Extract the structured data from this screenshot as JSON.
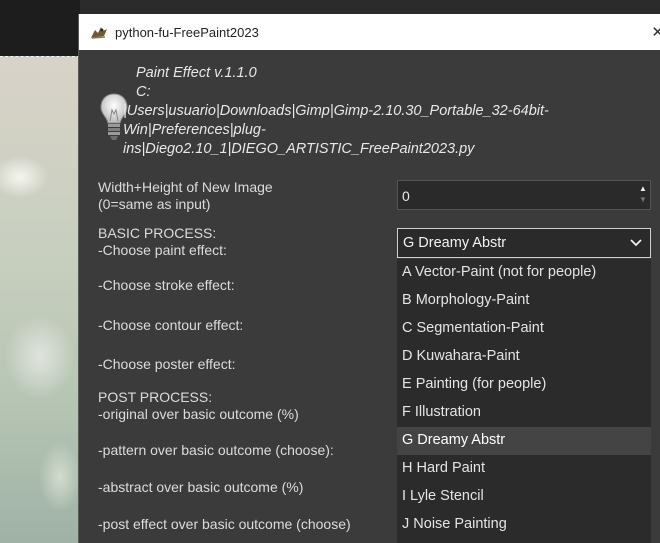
{
  "window": {
    "title": "python-fu-FreePaint2023",
    "close_glyph": "✕"
  },
  "about": {
    "line1": "Paint Effect v.1.1.0",
    "line2": "C:",
    "line3": "|Users|usuario|Downloads|Gimp|Gimp-2.10.30_Portable_32-64bit-",
    "line4": "Win|Preferences|plug-",
    "line5": "ins|Diego2.10_1|DIEGO_ARTISTIC_FreePaint2023.py"
  },
  "form": {
    "size_label_1": "Width+Height of New Image",
    "size_label_2": " (0=same as input)",
    "size_value": "0",
    "basic_heading": "BASIC PROCESS:",
    "paint_label": " -Choose paint effect:",
    "stroke_label": " -Choose stroke effect:",
    "contour_label": " -Choose contour effect:",
    "poster_label": " -Choose poster effect:",
    "post_heading": "POST PROCESS:",
    "original_label": " -original over basic outcome (%)",
    "pattern_label": "-pattern over basic outcome (choose):",
    "abstract_label": "-abstract over basic outcome (%)",
    "posteffect_label": "-post effect over basic outcome (choose)"
  },
  "paint_combo": {
    "selected": "G Dreamy Abstr",
    "options": [
      "A Vector-Paint (not for people)",
      "B Morphology-Paint",
      "C Segmentation-Paint",
      "D Kuwahara-Paint",
      "E Painting (for people)",
      "F Illustration",
      "G Dreamy Abstr",
      "H Hard Paint",
      "I Lyle Stencil",
      "J Noise Painting"
    ]
  },
  "icons": {
    "app": "gimp-wilber-icon",
    "info": "lightbulb-icon",
    "dropdown": "chevron-down-icon"
  },
  "colors": {
    "dialog_bg": "#3b3b3b",
    "dropdown_bg": "#2b2b2b",
    "highlight": "#444444",
    "titlebar": "#ffffff"
  }
}
